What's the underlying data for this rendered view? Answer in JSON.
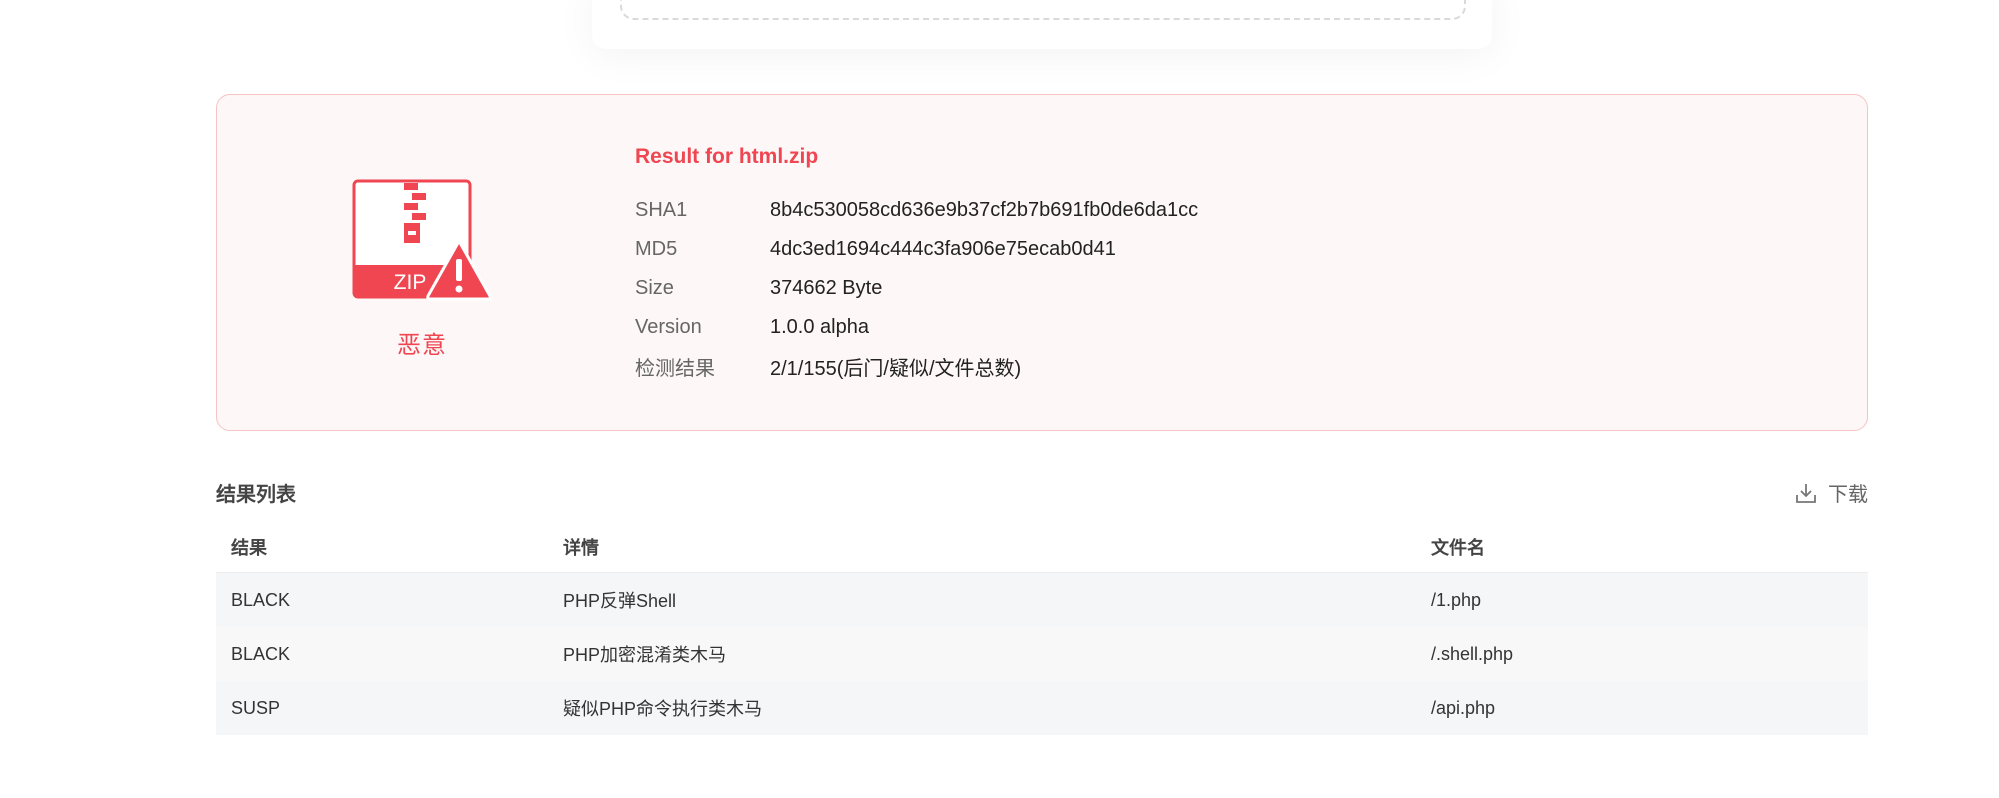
{
  "result": {
    "title": "Result for html.zip",
    "verdict": "恶意",
    "icon_text": "ZIP",
    "rows": [
      {
        "key": "SHA1",
        "value": "8b4c530058cd636e9b37cf2b7b691fb0de6da1cc"
      },
      {
        "key": "MD5",
        "value": "4dc3ed1694c444c3fa906e75ecab0d41"
      },
      {
        "key": "Size",
        "value": "374662 Byte"
      },
      {
        "key": "Version",
        "value": "1.0.0 alpha"
      },
      {
        "key": "检测结果",
        "value": "2/1/155(后门/疑似/文件总数)"
      }
    ]
  },
  "list": {
    "title": "结果列表",
    "download_label": "下载",
    "columns": [
      "结果",
      "详情",
      "文件名"
    ],
    "rows": [
      {
        "result": "BLACK",
        "detail": "PHP反弹Shell",
        "file": "/1.php"
      },
      {
        "result": "BLACK",
        "detail": "PHP加密混淆类木马",
        "file": "/.shell.php"
      },
      {
        "result": "SUSP",
        "detail": "疑似PHP命令执行类木马",
        "file": "/api.php"
      }
    ]
  },
  "colors": {
    "accent": "#ef4651",
    "panel_bg": "#fdf7f7",
    "panel_border": "#f6c3c6"
  },
  "icons": {
    "verdict": "zip-warning-icon",
    "download": "download-icon"
  }
}
